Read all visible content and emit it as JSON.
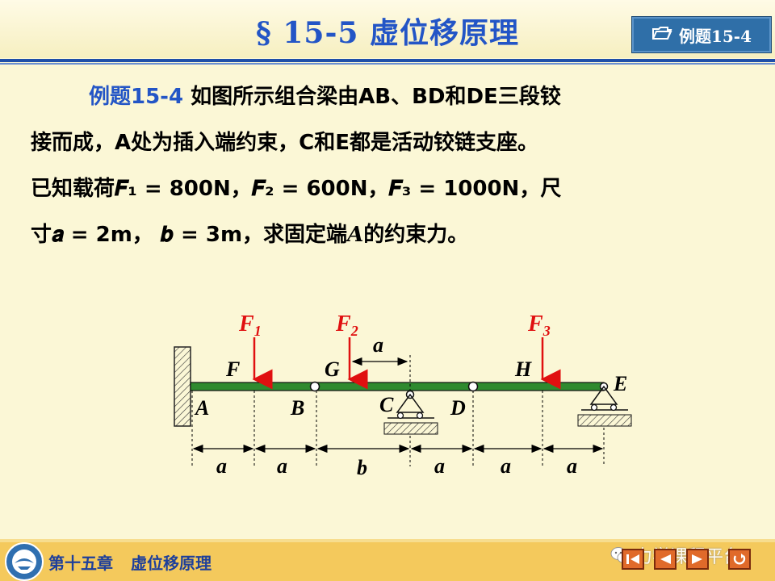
{
  "header": {
    "title": "§ 15-5   虚位移原理",
    "example_tag": "例题15-4"
  },
  "problem": {
    "label": "例题15-4",
    "line1": "如图所示组合梁由AB、BD和DE三段铰",
    "line2": "接而成，A处为插入端约束，C和E都是活动铰链支座。",
    "line3": "已知载荷𝑭₁ = 800N，𝑭₂ = 600N，𝑭₃ = 1000N，尺",
    "line4a": "寸𝒂 = 2m，  𝒃 = 3m，求固定端",
    "line4_italic": "A",
    "line4b": "的约束力。"
  },
  "diagram": {
    "forces": [
      {
        "label": "F",
        "sub": "1"
      },
      {
        "label": "F",
        "sub": "2"
      },
      {
        "label": "F",
        "sub": "3"
      }
    ],
    "points": {
      "A": "A",
      "B": "B",
      "C": "C",
      "D": "D",
      "E": "E",
      "F": "F",
      "G": "G",
      "H": "H"
    },
    "top_dim": "a",
    "dims": [
      "a",
      "a",
      "b",
      "a",
      "a",
      "a"
    ],
    "colors": {
      "force": "#e01010",
      "beam": "#2f8a2f",
      "text": "#000000"
    }
  },
  "footer": {
    "chapter": "第十五章",
    "section": "虚位移原理",
    "watermark": "力学课程平台"
  }
}
